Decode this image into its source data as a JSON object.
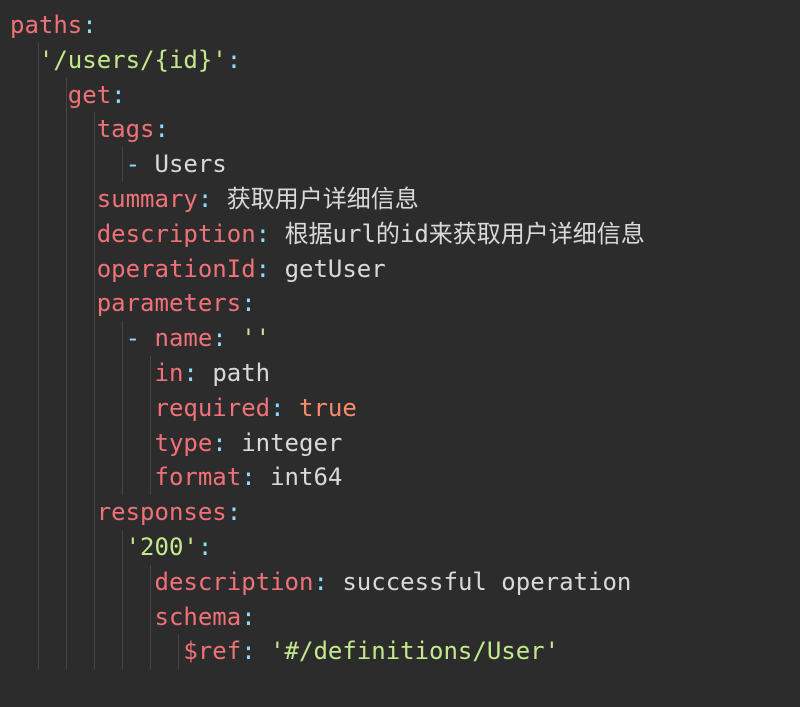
{
  "yaml": {
    "paths_key": "paths",
    "path_value": "'/users/{id}'",
    "get_key": "get",
    "tags_key": "tags",
    "tags_item": "Users",
    "summary_key": "summary",
    "summary_value": "获取用户详细信息",
    "description_key": "description",
    "description_value": "根据url的id来获取用户详细信息",
    "operationId_key": "operationId",
    "operationId_value": "getUser",
    "parameters_key": "parameters",
    "param_name_key": "name",
    "param_name_value": "''",
    "param_in_key": "in",
    "param_in_value": "path",
    "param_required_key": "required",
    "param_required_value": "true",
    "param_type_key": "type",
    "param_type_value": "integer",
    "param_format_key": "format",
    "param_format_value": "int64",
    "responses_key": "responses",
    "response_code": "'200'",
    "response_description_key": "description",
    "response_description_value": "successful operation",
    "schema_key": "schema",
    "ref_key": "$ref",
    "ref_value": "'#/definitions/User'"
  },
  "indent_unit": "  ",
  "guide_positions": [
    0,
    28,
    56,
    84,
    112,
    140,
    168
  ]
}
